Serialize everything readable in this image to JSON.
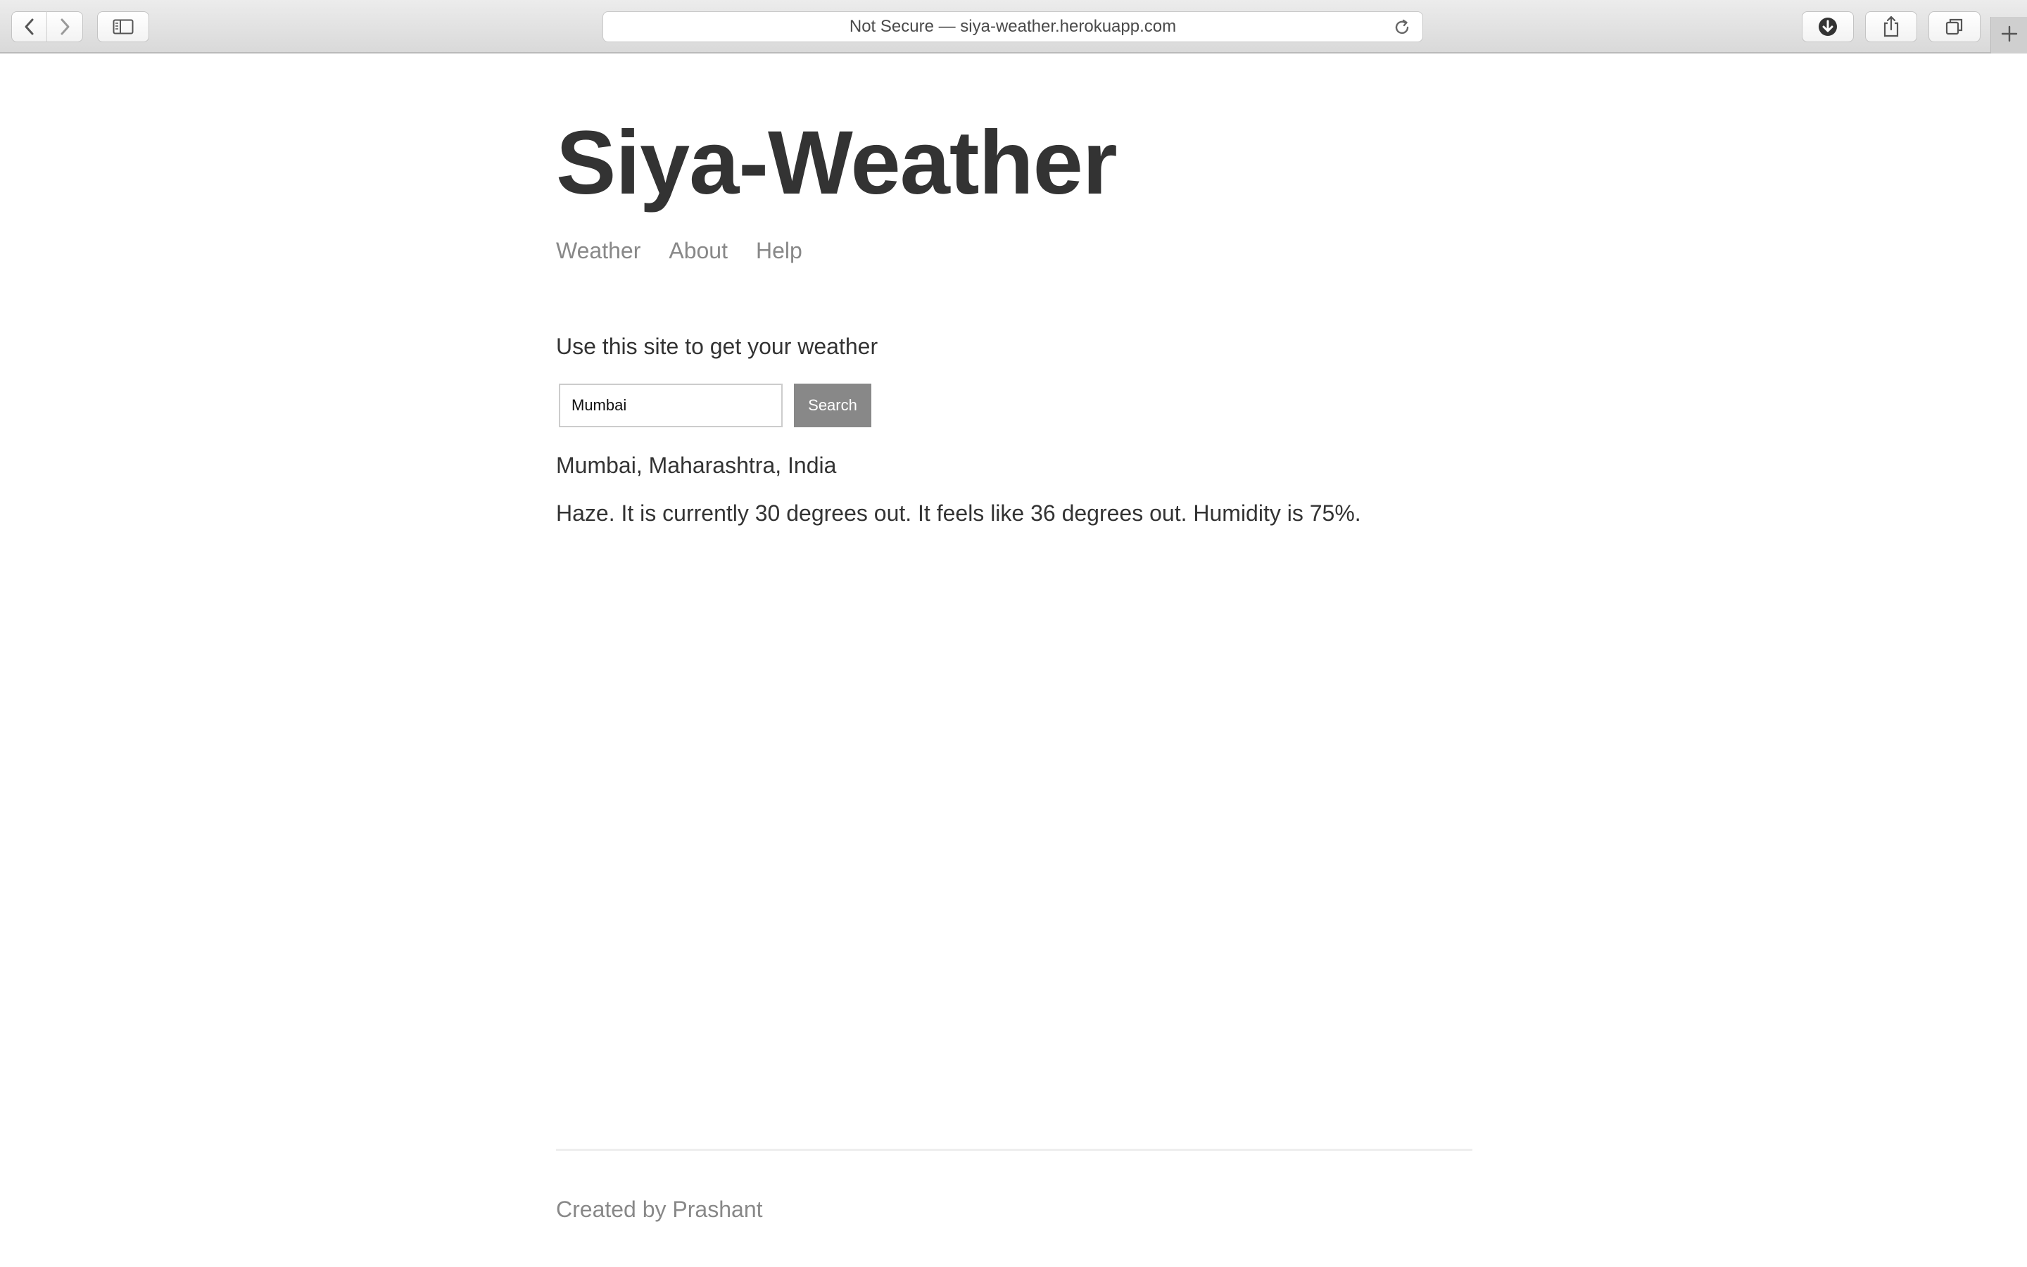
{
  "browser": {
    "address_text": "Not Secure — siya-weather.herokuapp.com",
    "icons": [
      "back-icon",
      "forward-icon",
      "sidebar-icon",
      "reload-icon",
      "download-icon",
      "share-icon",
      "tabs-icon",
      "new-tab-icon"
    ]
  },
  "page": {
    "title": "Siya-Weather",
    "nav": [
      "Weather",
      "About",
      "Help"
    ],
    "intro": "Use this site to get your weather",
    "search": {
      "value": "Mumbai",
      "button_label": "Search"
    },
    "result": {
      "location": "Mumbai, Maharashtra, India",
      "forecast": "Haze. It is currently 30 degrees out. It feels like 36 degrees out. Humidity is 75%."
    },
    "footer": "Created by Prashant"
  },
  "colors": {
    "title": "#333333",
    "nav_link": "#888888",
    "button_bg": "#888888",
    "button_text": "#ffffff"
  }
}
